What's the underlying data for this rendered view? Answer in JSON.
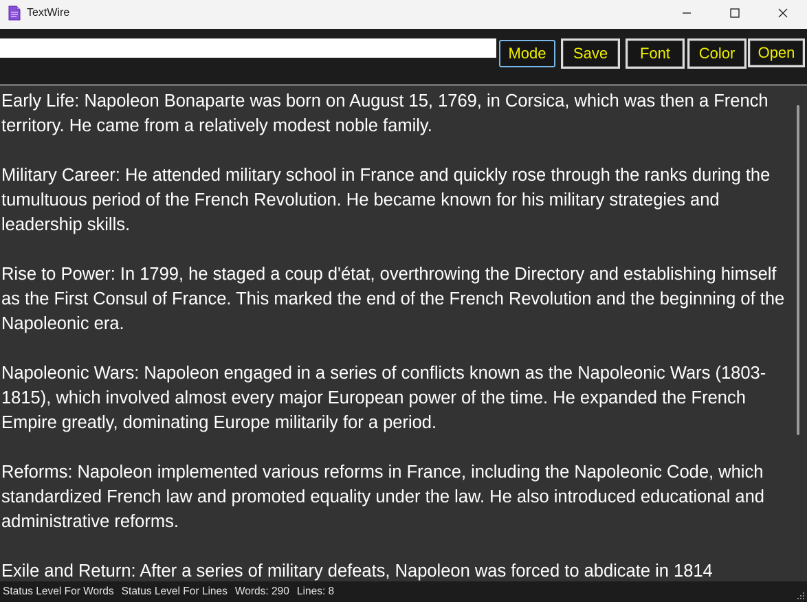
{
  "window": {
    "title": "TextWire",
    "controls": {
      "minimize_icon": "minimize-icon",
      "maximize_icon": "maximize-icon",
      "close_icon": "close-icon"
    }
  },
  "toolbar": {
    "input_value": "",
    "buttons": {
      "mode": "Mode",
      "save": "Save",
      "font": "Font",
      "color": "Color",
      "open": "Open"
    }
  },
  "editor": {
    "paragraphs": [
      "Early Life: Napoleon Bonaparte was born on August 15, 1769, in Corsica, which was then a French territory. He came from a relatively modest noble family.",
      "Military Career: He attended military school in France and quickly rose through the ranks during the tumultuous period of the French Revolution. He became known for his military strategies and leadership skills.",
      "Rise to Power: In 1799, he staged a coup d'état, overthrowing the Directory and establishing himself as the First Consul of France. This marked the end of the French Revolution and the beginning of the Napoleonic era.",
      "Napoleonic Wars: Napoleon engaged in a series of conflicts known as the Napoleonic Wars (1803-1815), which involved almost every major European power of the time. He expanded the French Empire greatly, dominating Europe militarily for a period.",
      "Reforms: Napoleon implemented various reforms in France, including the Napoleonic Code, which standardized French law and promoted equality under the law. He also introduced educational and administrative reforms.",
      "Exile and Return: After a series of military defeats, Napoleon was forced to abdicate in 1814"
    ]
  },
  "statusbar": {
    "words_level": "Status Level For Words",
    "lines_level": "Status Level For Lines",
    "words_count": "Words: 290",
    "lines_count": "Lines: 8"
  },
  "colors": {
    "button_text": "#f0f000",
    "editor_bg": "#333333",
    "toolbar_bg": "#1c1c1c",
    "mode_border": "#7ab7e8"
  }
}
